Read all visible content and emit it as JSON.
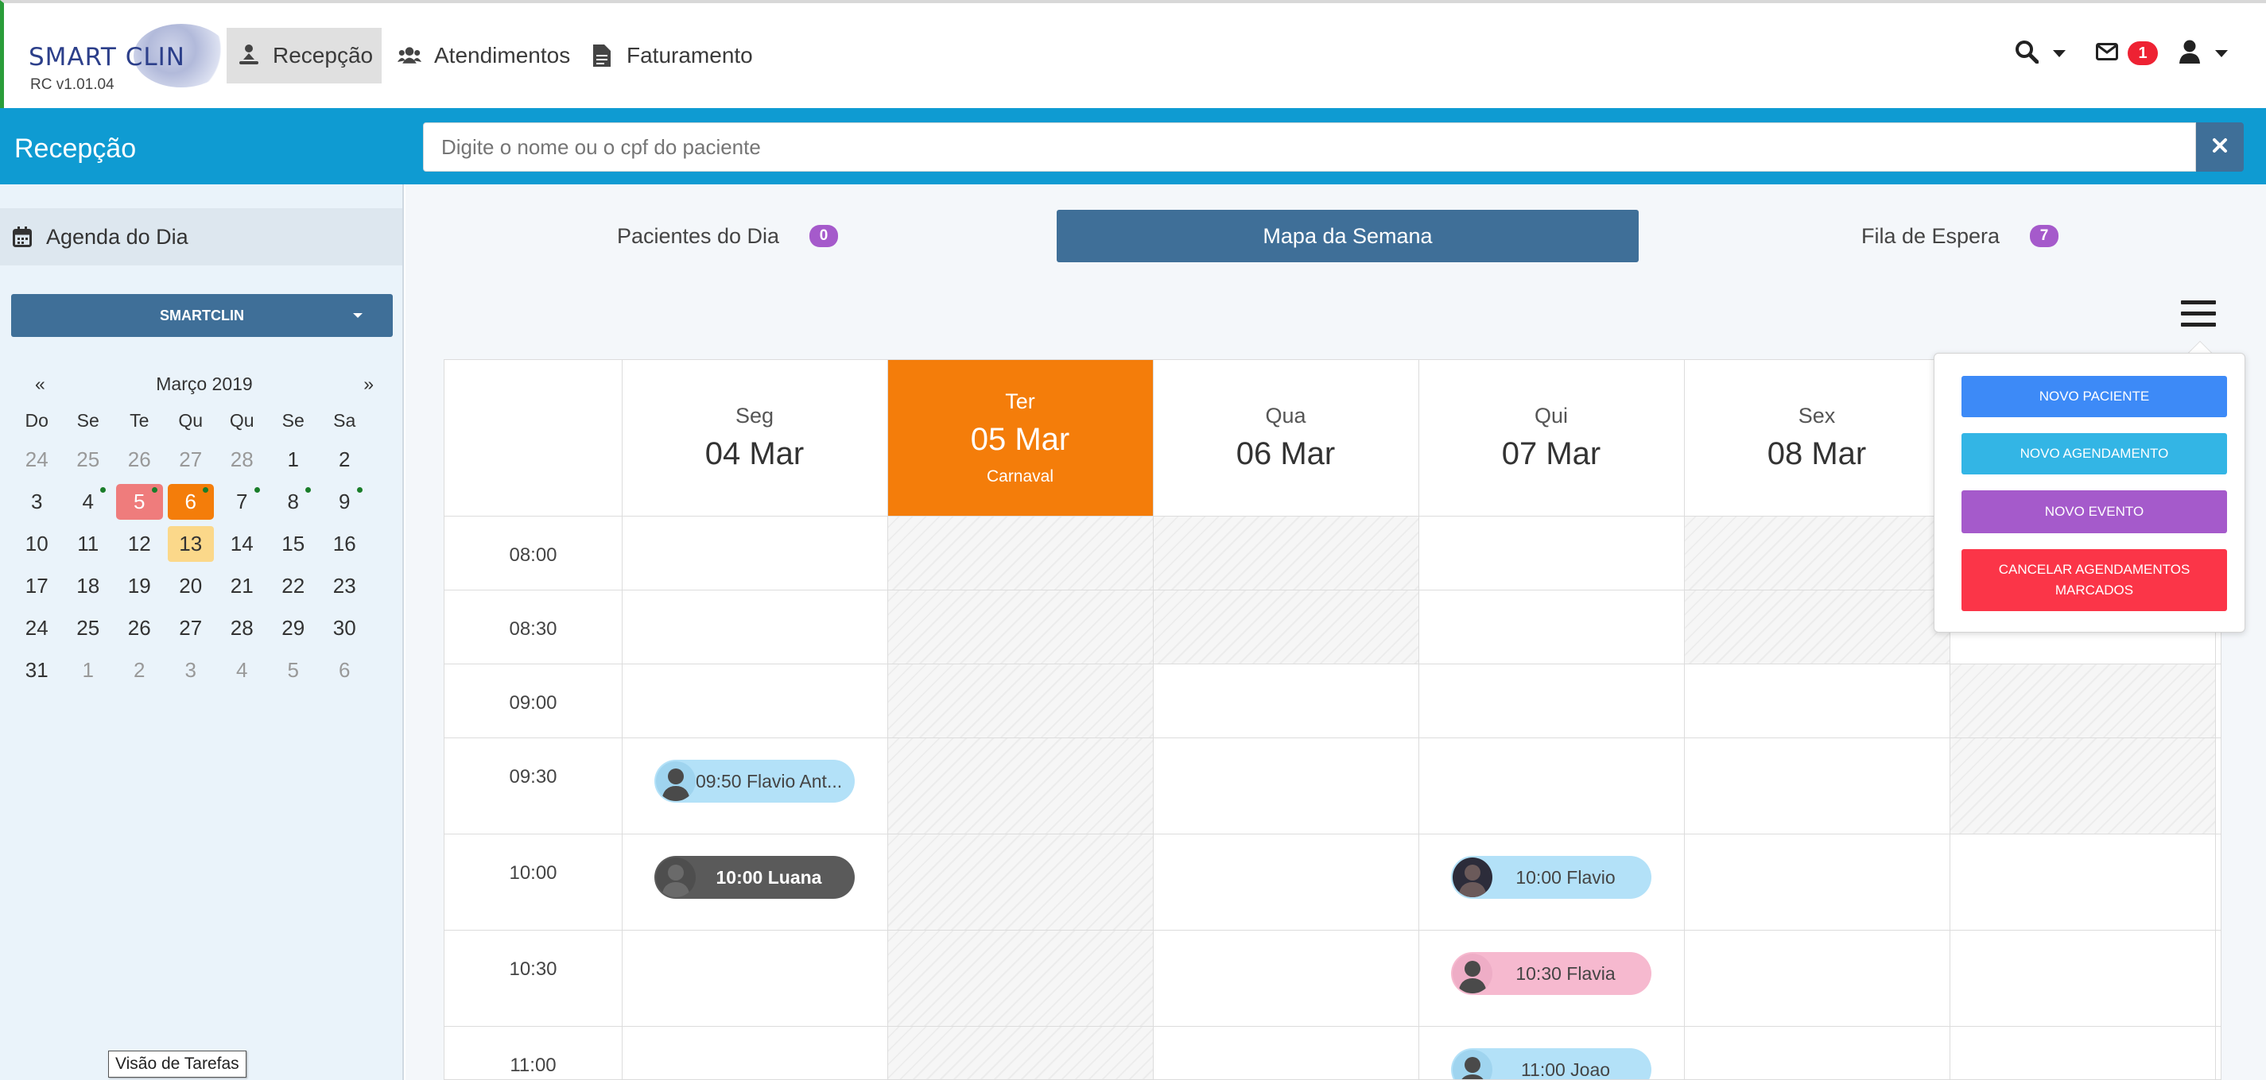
{
  "brand": {
    "name": "SMART CLIN",
    "version": "RC v1.01.04"
  },
  "nav": [
    {
      "label": "Recepção",
      "icon": "reception-icon",
      "active": true
    },
    {
      "label": "Atendimentos",
      "icon": "users-icon",
      "active": false
    },
    {
      "label": "Faturamento",
      "icon": "document-icon",
      "active": false
    }
  ],
  "toolbar": {
    "mail_count": "1"
  },
  "header": {
    "title": "Recepção"
  },
  "search": {
    "placeholder": "Digite o nome ou o cpf do paciente"
  },
  "sidebar": {
    "agenda_label": "Agenda do Dia",
    "clinic_select": "SMARTCLIN",
    "tooltip": "Visão de Tarefas",
    "calendar": {
      "prev": "«",
      "next": "»",
      "month": "Março 2019",
      "weekdays": [
        "Do",
        "Se",
        "Te",
        "Qu",
        "Qu",
        "Se",
        "Sa"
      ],
      "days": [
        {
          "n": "24",
          "muted": true
        },
        {
          "n": "25",
          "muted": true
        },
        {
          "n": "26",
          "muted": true
        },
        {
          "n": "27",
          "muted": true
        },
        {
          "n": "28",
          "muted": true
        },
        {
          "n": "1"
        },
        {
          "n": "2"
        },
        {
          "n": "3"
        },
        {
          "n": "4",
          "dot": true
        },
        {
          "n": "5",
          "style": "red",
          "dot": true
        },
        {
          "n": "6",
          "style": "orange",
          "dot": true
        },
        {
          "n": "7",
          "dot": true
        },
        {
          "n": "8",
          "dot": true
        },
        {
          "n": "9",
          "dot": true
        },
        {
          "n": "10"
        },
        {
          "n": "11"
        },
        {
          "n": "12"
        },
        {
          "n": "13",
          "style": "yellow"
        },
        {
          "n": "14"
        },
        {
          "n": "15"
        },
        {
          "n": "16"
        },
        {
          "n": "17"
        },
        {
          "n": "18"
        },
        {
          "n": "19"
        },
        {
          "n": "20"
        },
        {
          "n": "21"
        },
        {
          "n": "22"
        },
        {
          "n": "23"
        },
        {
          "n": "24"
        },
        {
          "n": "25"
        },
        {
          "n": "26"
        },
        {
          "n": "27"
        },
        {
          "n": "28"
        },
        {
          "n": "29"
        },
        {
          "n": "30"
        },
        {
          "n": "31"
        },
        {
          "n": "1",
          "muted": true
        },
        {
          "n": "2",
          "muted": true
        },
        {
          "n": "3",
          "muted": true
        },
        {
          "n": "4",
          "muted": true
        },
        {
          "n": "5",
          "muted": true
        },
        {
          "n": "6",
          "muted": true
        }
      ]
    }
  },
  "tabs": [
    {
      "label": "Pacientes do Dia",
      "count": "0"
    },
    {
      "label": "Mapa da Semana"
    },
    {
      "label": "Fila de Espera",
      "count": "7"
    }
  ],
  "week": {
    "days": [
      {
        "name": "Seg",
        "date": "04 Mar",
        "sub": ""
      },
      {
        "name": "Ter",
        "date": "05 Mar",
        "sub": "Carnaval",
        "today": true
      },
      {
        "name": "Qua",
        "date": "06 Mar",
        "sub": ""
      },
      {
        "name": "Qui",
        "date": "07 Mar",
        "sub": ""
      },
      {
        "name": "Sex",
        "date": "08 Mar",
        "sub": ""
      }
    ],
    "times": [
      "08:00",
      "08:30",
      "09:00",
      "09:30",
      "10:00",
      "10:30",
      "11:00"
    ],
    "appointments": [
      {
        "label": "09:50 Flavio Ant...",
        "day": 0,
        "slot": 3,
        "style": "blue"
      },
      {
        "label": "10:00 Luana",
        "day": 0,
        "slot": 4,
        "style": "dark"
      },
      {
        "label": "10:00 Flavio",
        "day": 3,
        "slot": 4,
        "style": "blue",
        "photo": true
      },
      {
        "label": "10:30 Flavia",
        "day": 3,
        "slot": 5,
        "style": "pink"
      },
      {
        "label": "11:00 Joao",
        "day": 3,
        "slot": 6,
        "style": "blue"
      }
    ]
  },
  "menu": {
    "new_patient": "NOVO PACIENTE",
    "new_appointment": "NOVO AGENDAMENTO",
    "new_event": "NOVO EVENTO",
    "cancel_appointments": "CANCELAR AGENDAMENTOS MARCADOS"
  },
  "colors": {
    "primary": "#3f6f98",
    "header_blue": "#0f9bd2",
    "today_orange": "#f47d0a",
    "menu_blue": "#3d8af7",
    "menu_cyan": "#33b5e5",
    "menu_purple": "#a55acb",
    "menu_red": "#fb3548"
  }
}
